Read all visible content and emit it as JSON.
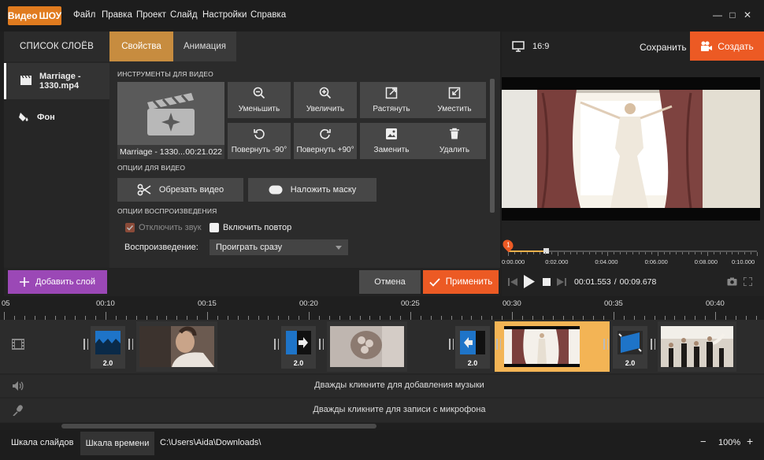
{
  "app": {
    "logo_part1": "Видео",
    "logo_part2": "ШОУ"
  },
  "menu": [
    "Файл",
    "Правка",
    "Проект",
    "Слайд",
    "Настройки",
    "Справка"
  ],
  "window": {
    "minimize": "—",
    "maximize": "□",
    "close": "✕"
  },
  "left_panel": {
    "layers_header": "СПИСОК СЛОЁВ",
    "tabs": [
      "Свойства",
      "Анимация"
    ],
    "layers": [
      {
        "label": "Marriage - 1330.mp4",
        "icon": "film-icon"
      },
      {
        "label": "Фон",
        "icon": "paint-bucket-icon"
      }
    ],
    "video_tools_label": "ИНСТРУМЕНТЫ ДЛЯ ВИДЕО",
    "thumb_name": "Marriage - 1330...",
    "thumb_duration": "00:21.022",
    "tools": [
      "Уменьшить",
      "Увеличить",
      "Растянуть",
      "Уместить",
      "Повернуть -90°",
      "Повернуть +90°",
      "Заменить",
      "Удалить"
    ],
    "video_options_label": "ОПЦИИ ДЛЯ ВИДЕО",
    "crop_video": "Обрезать видео",
    "apply_mask": "Наложить маску",
    "playback_options_label": "ОПЦИИ ВОСПРОИЗВЕДЕНИЯ",
    "mute_label": "Отключить звук",
    "loop_label": "Включить повтор",
    "playback_label": "Воспроизведение:",
    "playback_value": "Проиграть сразу",
    "add_layer": "Добавить слой",
    "cancel": "Отмена",
    "apply": "Применить"
  },
  "right_panel": {
    "aspect": "16:9",
    "save": "Сохранить",
    "create": "Создать",
    "ruler_ticks": [
      "0:00.000",
      "0:02.000",
      "0:04.000",
      "0:06.000",
      "0:08.000",
      "0:10.000"
    ],
    "current_time": "00:01.553",
    "total_time": "00:09.678",
    "time_separator": "/",
    "marker": "1",
    "progress_fraction": 0.16
  },
  "timeline": {
    "ticks": [
      "05",
      "00:10",
      "00:15",
      "00:20",
      "00:25",
      "00:30",
      "00:35",
      "00:40"
    ],
    "transition_duration": "2.0",
    "music_hint": "Дважды кликните для добавления музыки",
    "mic_hint": "Дважды кликните для записи с микрофона"
  },
  "status": {
    "tab_slides": "Шкала слайдов",
    "tab_timeline": "Шкала времени",
    "path": "C:\\Users\\Aida\\Downloads\\",
    "zoom_out": "−",
    "zoom": "100%",
    "zoom_in": "+"
  },
  "colors": {
    "accent_orange": "#ec5a24",
    "tab_gold": "#c78c3f",
    "purple": "#9b48b6",
    "selected_clip": "#f3b455"
  }
}
